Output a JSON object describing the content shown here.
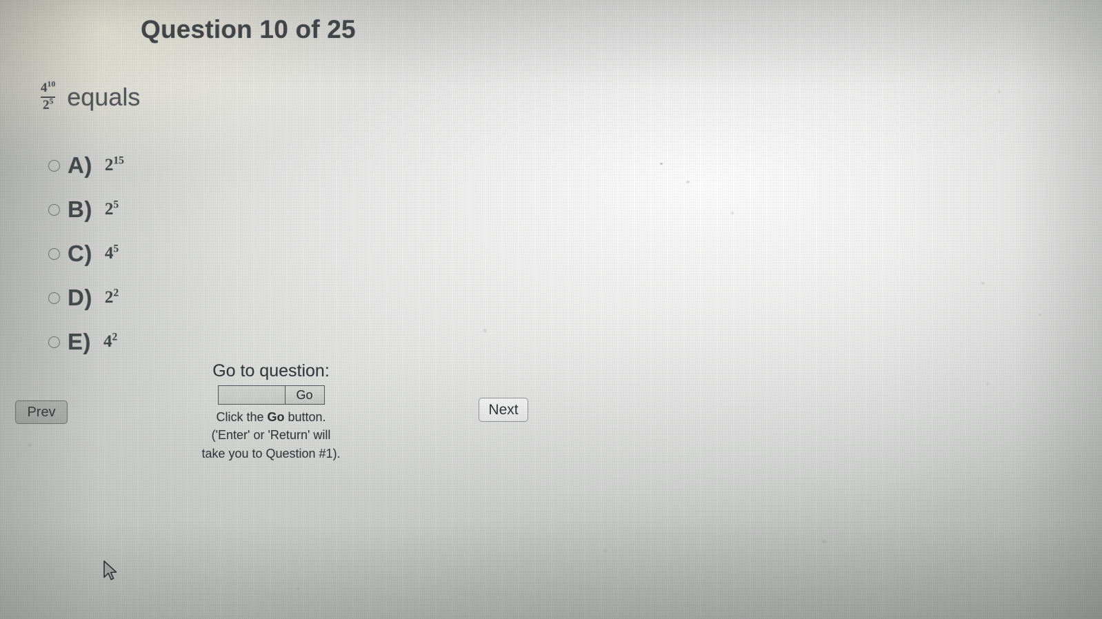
{
  "header": {
    "title": "Question 10 of 25"
  },
  "question": {
    "fraction": {
      "numerator_base": "4",
      "numerator_exponent": "10",
      "denominator_base": "2",
      "denominator_exponent": "5"
    },
    "stem_text": "equals"
  },
  "options": [
    {
      "letter": "A)",
      "base": "2",
      "exponent": "15",
      "selected": false
    },
    {
      "letter": "B)",
      "base": "2",
      "exponent": "5",
      "selected": false
    },
    {
      "letter": "C)",
      "base": "4",
      "exponent": "5",
      "selected": false
    },
    {
      "letter": "D)",
      "base": "2",
      "exponent": "2",
      "selected": false
    },
    {
      "letter": "E)",
      "base": "4",
      "exponent": "2",
      "selected": false
    }
  ],
  "goto": {
    "label": "Go to question:",
    "input_value": "",
    "input_placeholder": "",
    "go_label": "Go",
    "help_line1_before": "Click the ",
    "help_line1_bold": "Go",
    "help_line1_after": " button.",
    "help_line2": "('Enter' or 'Return' will",
    "help_line3": "take you to Question #1)."
  },
  "navigation": {
    "prev_label": "Prev",
    "next_label": "Next"
  },
  "colors": {
    "text_dark": "#3b3f42",
    "text_body": "#4e5356",
    "radio_outline": "#6f7478",
    "button_border": "#4d5154",
    "screen_light": "#cdcfcc",
    "screen_edge": "#a7a9a7"
  }
}
